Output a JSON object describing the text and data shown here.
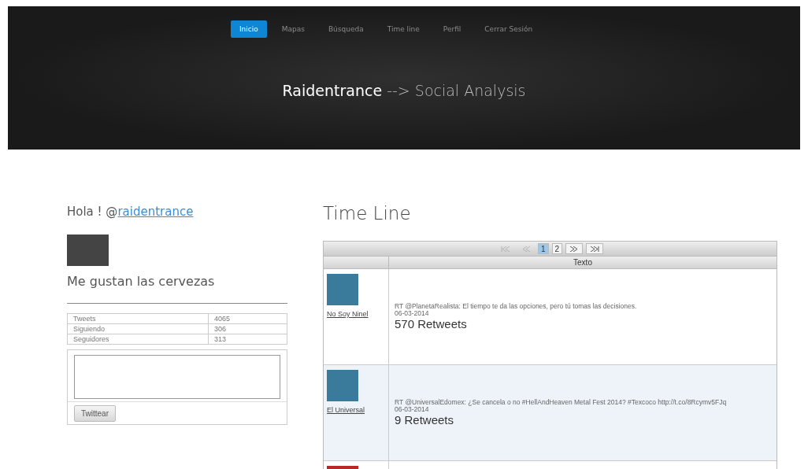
{
  "nav": [
    {
      "label": "Inicio",
      "selected": true
    },
    {
      "label": "Mapas",
      "selected": false
    },
    {
      "label": "Búsqueda",
      "selected": false
    },
    {
      "label": "Time line",
      "selected": false
    },
    {
      "label": "Perfil",
      "selected": false
    },
    {
      "label": "Cerrar Sesión",
      "selected": false
    }
  ],
  "hero": {
    "brand": "Raidentrance",
    "arrow": "-->",
    "subtitle": "Social Analysis"
  },
  "profile": {
    "greeting": "Hola ! @",
    "handle": "raidentrance",
    "bio": "Me gustan las cervezas",
    "stats": [
      {
        "label": "Tweets",
        "value": "4065"
      },
      {
        "label": "Siguiendo",
        "value": "306"
      },
      {
        "label": "Seguidores",
        "value": "313"
      }
    ],
    "tweet_button": "Twittear"
  },
  "timeline": {
    "title": "Time Line",
    "pager": [
      {
        "kind": "first",
        "disabled": true
      },
      {
        "kind": "prev",
        "disabled": true
      },
      {
        "kind": "page",
        "label": "1",
        "selected": true
      },
      {
        "kind": "page",
        "label": "2",
        "selected": false
      },
      {
        "kind": "next",
        "disabled": false
      },
      {
        "kind": "last",
        "disabled": false
      }
    ],
    "column": "Texto",
    "rows": [
      {
        "kind": "tweet",
        "user": "No Soy Ninel",
        "text": "RT @PlanetaRealista: El tiempo te da las opciones, pero tú tomas las decisiones.",
        "date": "06-03-2014",
        "retweets": "570 Retweets",
        "shaded": false
      },
      {
        "kind": "tweet",
        "user": "El Universal",
        "text": "RT @UniversalEdomex: ¿Se cancela o no #HellAndHeaven Metal Fest 2014? #Texcoco http://t.co/8Rcymv5FJq",
        "date": "06-03-2014",
        "retweets": "9 Retweets",
        "shaded": true
      },
      {
        "kind": "cut"
      }
    ]
  }
}
